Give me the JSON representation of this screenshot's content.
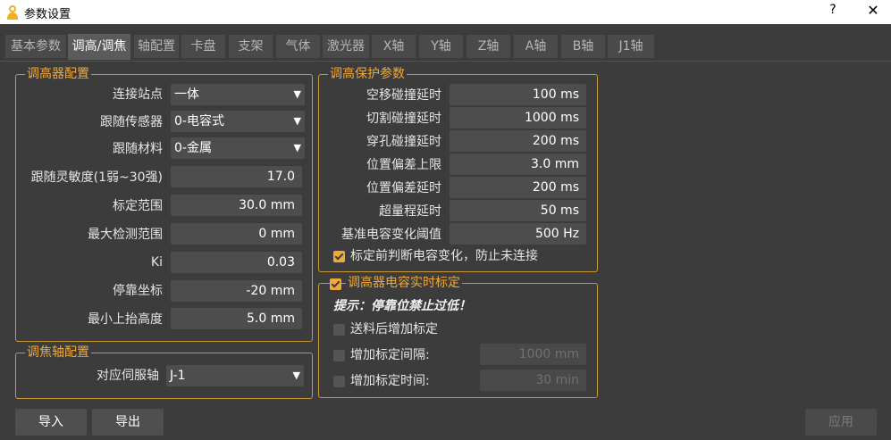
{
  "window": {
    "title": "参数设置",
    "help": "?",
    "close": "✕"
  },
  "tabs": [
    {
      "label": "基本参数"
    },
    {
      "label": "调高/调焦",
      "active": true
    },
    {
      "label": "轴配置"
    },
    {
      "label": "卡盘"
    },
    {
      "label": "支架"
    },
    {
      "label": "气体"
    },
    {
      "label": "激光器"
    },
    {
      "label": "X轴"
    },
    {
      "label": "Y轴"
    },
    {
      "label": "Z轴"
    },
    {
      "label": "A轴"
    },
    {
      "label": "B轴"
    },
    {
      "label": "J1轴"
    }
  ],
  "height_config": {
    "title": "调高器配置",
    "station": {
      "label": "连接站点",
      "value": "一体"
    },
    "sensor": {
      "label": "跟随传感器",
      "value": "0-电容式"
    },
    "material": {
      "label": "跟随材料",
      "value": "0-金属"
    },
    "sensitivity": {
      "label": "跟随灵敏度(1弱~30强)",
      "value": "17.0"
    },
    "calib_range": {
      "label": "标定范围",
      "value": "30.0 mm"
    },
    "max_detect": {
      "label": "最大检测范围",
      "value": "0 mm"
    },
    "ki": {
      "label": "Ki",
      "value": "0.03"
    },
    "park_coord": {
      "label": "停靠坐标",
      "value": "-20 mm"
    },
    "min_lift": {
      "label": "最小上抬高度",
      "value": "5.0 mm"
    }
  },
  "focus_config": {
    "title": "调焦轴配置",
    "servo": {
      "label": "对应伺服轴",
      "value": "J-1"
    }
  },
  "protection": {
    "title": "调高保护参数",
    "move_collision": {
      "label": "空移碰撞延时",
      "value": "100 ms"
    },
    "cut_collision": {
      "label": "切割碰撞延时",
      "value": "1000 ms"
    },
    "pierce_collision": {
      "label": "穿孔碰撞延时",
      "value": "200 ms"
    },
    "pos_dev_limit": {
      "label": "位置偏差上限",
      "value": "3.0 mm"
    },
    "pos_dev_delay": {
      "label": "位置偏差延时",
      "value": "200 ms"
    },
    "overtravel": {
      "label": "超量程延时",
      "value": "50 ms"
    },
    "cap_threshold": {
      "label": "基准电容变化阈值",
      "value": "500 Hz"
    },
    "precheck": {
      "label": "标定前判断电容变化，防止未连接",
      "checked": true
    }
  },
  "realtime": {
    "title": "调高器电容实时标定",
    "enabled": true,
    "hint": "提示：停靠位禁止过低！",
    "after_feed": {
      "label": "送料后增加标定",
      "checked": false
    },
    "interval": {
      "label": "增加标定间隔:",
      "value": "1000 mm",
      "checked": false
    },
    "time": {
      "label": "增加标定时间:",
      "value": "30 min",
      "checked": false
    }
  },
  "buttons": {
    "import": "导入",
    "export": "导出",
    "apply": "应用"
  }
}
